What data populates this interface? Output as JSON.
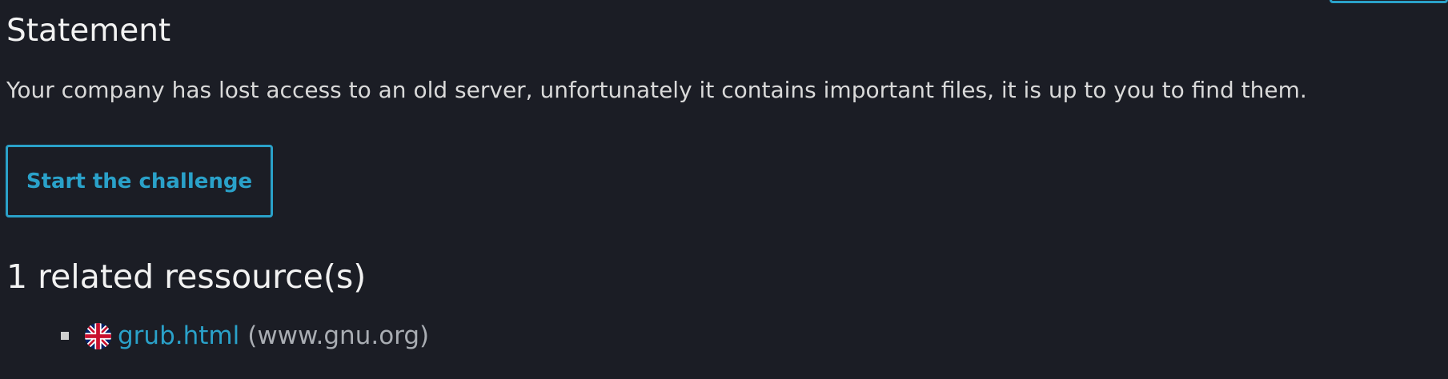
{
  "statement": {
    "heading": "Statement",
    "text": "Your company has lost access to an old server, unfortunately it contains important files, it is up to you to find them."
  },
  "challenge": {
    "button_label": "Start the challenge"
  },
  "resources": {
    "heading": "1 related ressource(s)",
    "items": [
      {
        "link_text": "grub.html",
        "domain": "(www.gnu.org)",
        "flag_icon": "uk-flag-icon"
      }
    ]
  },
  "colors": {
    "background": "#1b1d25",
    "accent": "#2aa1c9",
    "text": "#d9d9d9",
    "muted": "#a9adb3"
  }
}
